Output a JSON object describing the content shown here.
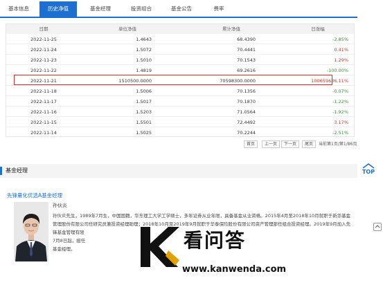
{
  "tabs": [
    {
      "label": "基本信息",
      "active": false
    },
    {
      "label": "历史净值",
      "active": true
    },
    {
      "label": "基金经理",
      "active": false
    },
    {
      "label": "投资组合",
      "active": false
    },
    {
      "label": "基金公告",
      "active": false
    },
    {
      "label": "费率",
      "active": false
    }
  ],
  "table": {
    "headers": {
      "date": "日期",
      "unit": "单位净值",
      "acc": "累计净值",
      "pct": "日涨幅"
    },
    "rows": [
      {
        "date": "2022-11-25",
        "unit": "1.4643",
        "acc": "68.4390",
        "pct": "-2.85%",
        "dir": "neg"
      },
      {
        "date": "2022-11-24",
        "unit": "1.5072",
        "acc": "70.4441",
        "pct": "0.41%",
        "dir": "pos"
      },
      {
        "date": "2022-11-23",
        "unit": "1.5010",
        "acc": "70.1543",
        "pct": "1.29%",
        "dir": "pos"
      },
      {
        "date": "2022-11-22",
        "unit": "1.4819",
        "acc": "69.2616",
        "pct": "-100.00%",
        "dir": "neg"
      },
      {
        "date": "2022-11-21",
        "unit": "1510500.0000",
        "acc": "70598300.0000",
        "pct": "100659636.11%",
        "dir": "pos"
      },
      {
        "date": "2022-11-18",
        "unit": "1.5006",
        "acc": "70.1356",
        "pct": "-0.07%",
        "dir": "neg"
      },
      {
        "date": "2022-11-17",
        "unit": "1.5017",
        "acc": "70.1870",
        "pct": "-1.22%",
        "dir": "neg"
      },
      {
        "date": "2022-11-16",
        "unit": "1.5203",
        "acc": "71.0564",
        "pct": "-1.92%",
        "dir": "neg"
      },
      {
        "date": "2022-11-15",
        "unit": "1.5501",
        "acc": "72.4492",
        "pct": "3.17%",
        "dir": "pos"
      },
      {
        "date": "2022-11-14",
        "unit": "1.5025",
        "acc": "70.2244",
        "pct": "-2.51%",
        "dir": "neg"
      }
    ]
  },
  "pager": {
    "first": "首页",
    "prev": "上一页",
    "next": "下一页",
    "last": "尾页",
    "info": "当前第1页/第1/86页"
  },
  "section": {
    "title": "基金经理",
    "manager_link": "先锋量化优选A基金经理",
    "manager_name": "孙伙炎",
    "bio": [
      "孙伙炎先生，1989年7月生，中国国籍，华东理工大学工学硕士，多年证券从业年限，具备基金从业资格。2015年4月至2018年10月就职于新华基金",
      "管理股份有限公司任研究员兼投资经理助理；2018年10月至2019年9月就职于华泰保险股份有限公司资产管理部任组合投资经理。2019年9月加入先",
      "锋基金管理有限",
      "7月8日起，担任",
      "基金经理。"
    ]
  },
  "back_top": "TOP",
  "watermark": {
    "text": "看问答",
    "url": "www.kanwenda.com"
  },
  "colors": {
    "accent": "#1f6fd1",
    "positive": "#e0342b",
    "negative": "#2aa12a",
    "highlight_border": "#d42b2b"
  }
}
